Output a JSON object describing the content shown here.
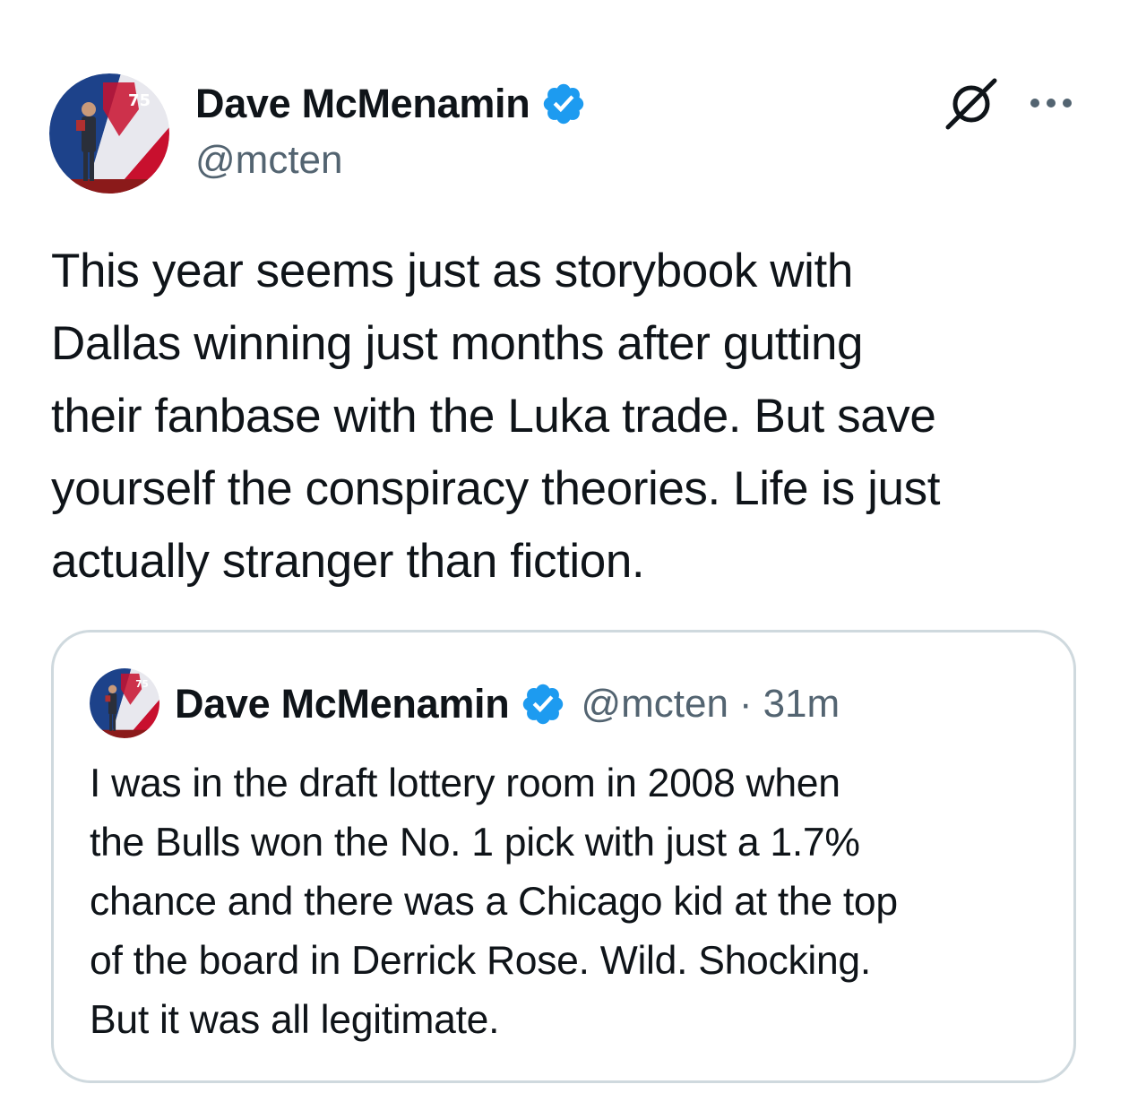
{
  "tweet": {
    "author": {
      "display_name": "Dave McMenamin",
      "handle": "@mcten",
      "verified_icon": "verified-badge-icon",
      "avatar": "profile-photo"
    },
    "actions": {
      "grok_icon": "grok-slash-icon",
      "more_icon": "more-options-icon"
    },
    "text": "This year seems just as storybook with\nDallas winning just months after gutting\ntheir fanbase with the Luka trade. But save\nyourself the conspiracy theories. Life is just\nactually stranger than fiction."
  },
  "quoted_tweet": {
    "author": {
      "display_name": "Dave McMenamin",
      "handle": "@mcten",
      "verified_icon": "verified-badge-icon"
    },
    "separator": "·",
    "timestamp": "31m",
    "text": "I was in the draft lottery room in 2008 when\nthe Bulls won the No. 1 pick with just a 1.7%\nchance and there was a Chicago kid at the top\nof the board in Derrick Rose. Wild. Shocking.\nBut it was all legitimate."
  },
  "colors": {
    "text_primary": "#0f1419",
    "text_secondary": "#536471",
    "verified_blue": "#1d9bf0",
    "border": "#cfd9de"
  }
}
